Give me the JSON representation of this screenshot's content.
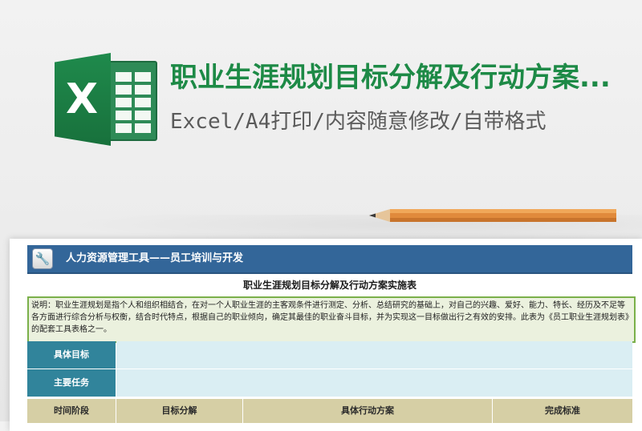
{
  "banner": {
    "logo_letter": "X",
    "title": "职业生涯规划目标分解及行动方案...",
    "subtitle": "Excel/A4打印/内容随意修改/自带格式",
    "colors": {
      "brand_green": "#1d8a46",
      "subtitle_gray": "#5b5b5b"
    }
  },
  "sheet": {
    "tool_header": {
      "icon": "wrench-icon",
      "title": "人力资源管理工具——员工培训与开发",
      "color": "#336699"
    },
    "title": "职业生涯规划目标分解及行动方案实施表",
    "description": "说明：职业生涯规划是指个人和组织相结合，在对一个人职业生涯的主客观条件进行测定、分析、总结研究的基础上，对自己的兴趣、爱好、能力、特长、经历及不足等各方面进行综合分析与权衡，结合时代特点，根据自己的职业倾向，确定其最佳的职业奋斗目标，并为实现这一目标做出行之有效的安排。此表为《员工职业生涯规划表》的配套工具表格之一。",
    "rows": [
      {
        "label": "具体目标",
        "value": ""
      },
      {
        "label": "主要任务",
        "value": ""
      }
    ],
    "columns": [
      "时间阶段",
      "目标分解",
      "具体行动方案",
      "完成标准"
    ]
  }
}
